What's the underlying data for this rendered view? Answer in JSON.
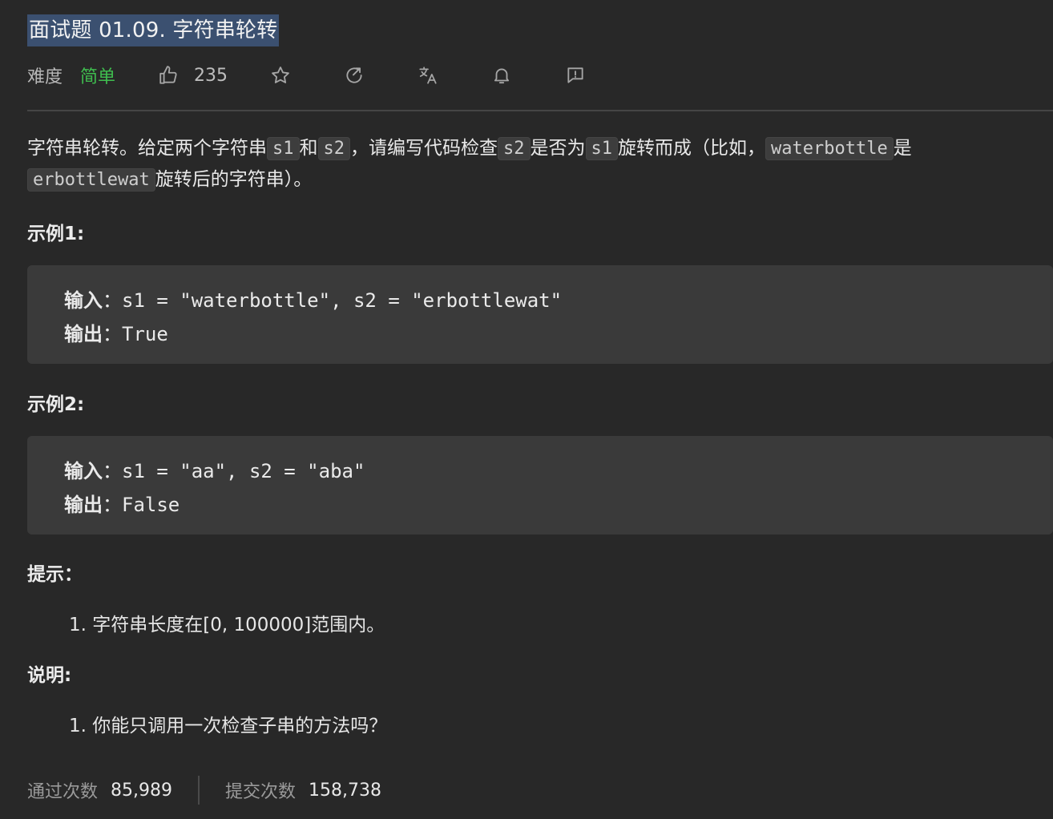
{
  "title": "面试题 01.09. 字符串轮转",
  "meta": {
    "difficulty_label": "难度",
    "difficulty_value": "简单",
    "likes": "235",
    "icons": [
      "thumbs-up-icon",
      "star-icon",
      "share-icon",
      "translate-icon",
      "bell-icon",
      "feedback-icon"
    ]
  },
  "description": {
    "p1_a": "字符串轮转。给定两个字符串",
    "code_s1": "s1",
    "p1_b": "和",
    "code_s2": "s2",
    "p1_c": "，请编写代码检查",
    "code_s2b": "s2",
    "p1_d": "是否为",
    "code_s1b": "s1",
    "p1_e": "旋转而成（比如，",
    "code_word1": "waterbottle",
    "p1_f": "是",
    "code_word2": "erbottlewat",
    "p1_g": "旋转后的字符串）。"
  },
  "example1": {
    "title": "示例1:",
    "input_label": "输入",
    "input_value": "：s1 = \"waterbottle\", s2 = \"erbottlewat\"",
    "output_label": "输出",
    "output_value": "：True"
  },
  "example2": {
    "title": "示例2:",
    "input_label": "输入",
    "input_value": "：s1 = \"aa\", s2 = \"aba\"",
    "output_label": "输出",
    "output_value": "：False"
  },
  "hints": {
    "title": "提示：",
    "items": [
      "1. 字符串长度在[0, 100000]范围内。"
    ]
  },
  "notes": {
    "title": "说明:",
    "items": [
      "1. 你能只调用一次检查子串的方法吗？"
    ]
  },
  "stats": {
    "accepted_label": "通过次数",
    "accepted_value": "85,989",
    "submissions_label": "提交次数",
    "submissions_value": "158,738"
  }
}
